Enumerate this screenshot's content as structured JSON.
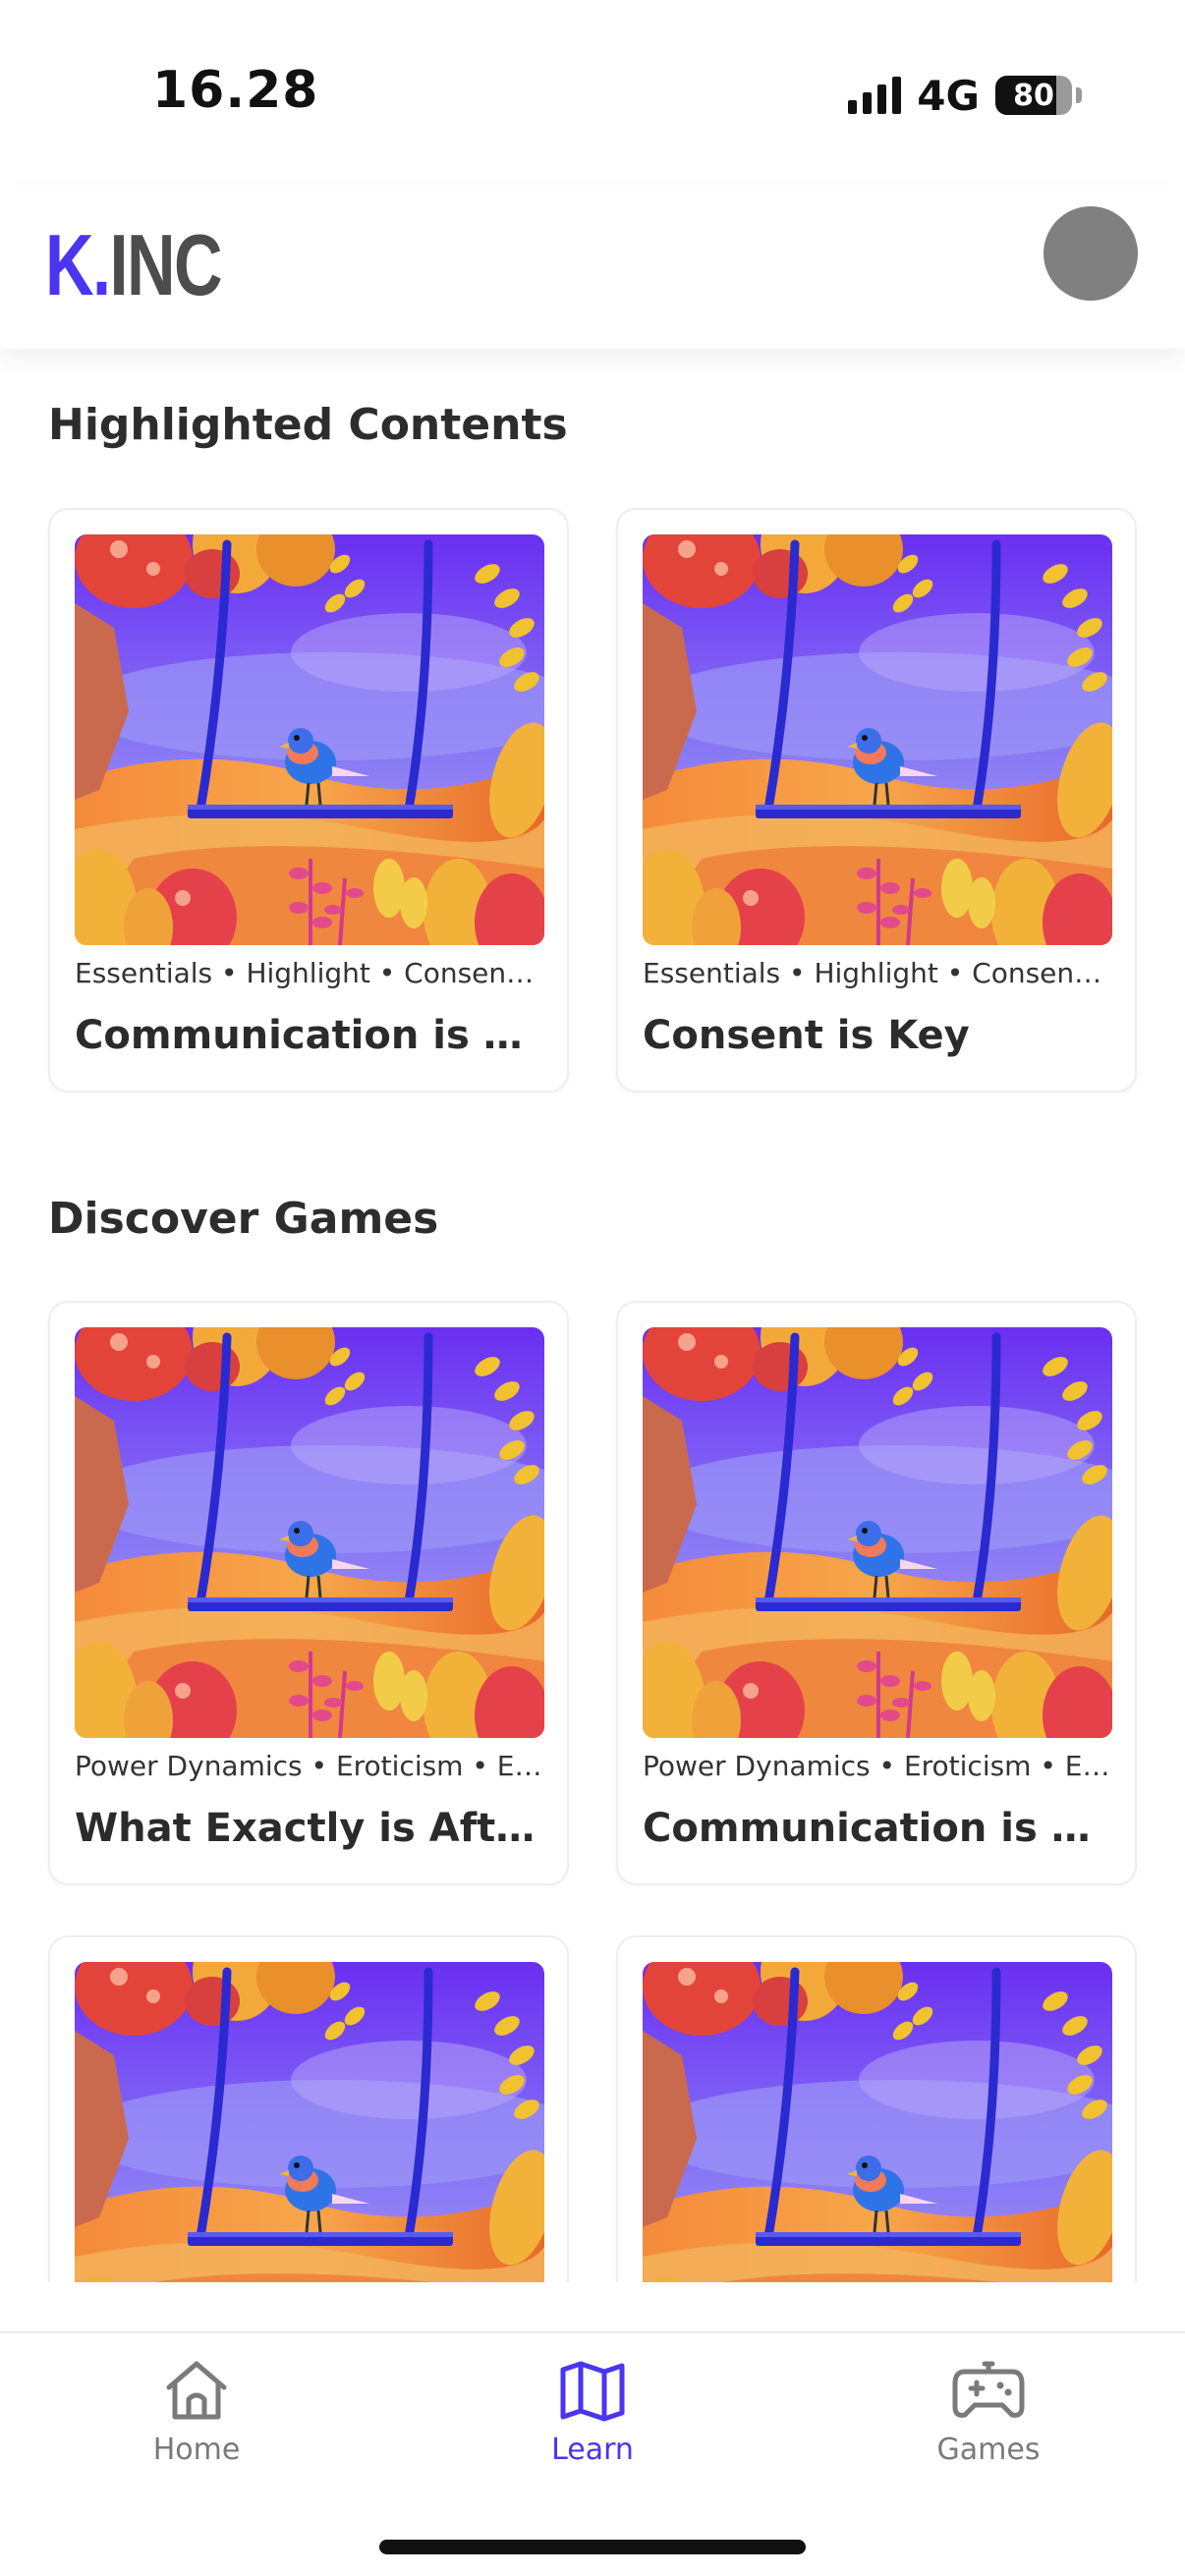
{
  "status_bar": {
    "time": "16.28",
    "network": "4G",
    "battery": "80"
  },
  "header": {
    "logo_k": "K.",
    "logo_rest": "INC",
    "brand_color": "#4a35f0"
  },
  "sections": {
    "highlighted": {
      "title": "Highlighted Contents",
      "cards": [
        {
          "tags": "Essentials • Highlight • Consensual",
          "title": "Communication is Key"
        },
        {
          "tags": "Essentials • Highlight • Consensual",
          "title": "Consent is Key"
        }
      ]
    },
    "games": {
      "title": "Discover Games",
      "cards": [
        {
          "tags": "Power Dynamics • Eroticism • Essentials",
          "title": "What Exactly is Aftercare?"
        },
        {
          "tags": "Power Dynamics • Eroticism • Essentials",
          "title": "Communication is Key"
        },
        {
          "tags": "",
          "title": ""
        },
        {
          "tags": "",
          "title": ""
        }
      ]
    }
  },
  "bottom_nav": {
    "items": [
      {
        "label": "Home",
        "icon": "home-icon",
        "active": false
      },
      {
        "label": "Learn",
        "icon": "map-icon",
        "active": true
      },
      {
        "label": "Games",
        "icon": "gamepad-icon",
        "active": false
      }
    ]
  }
}
